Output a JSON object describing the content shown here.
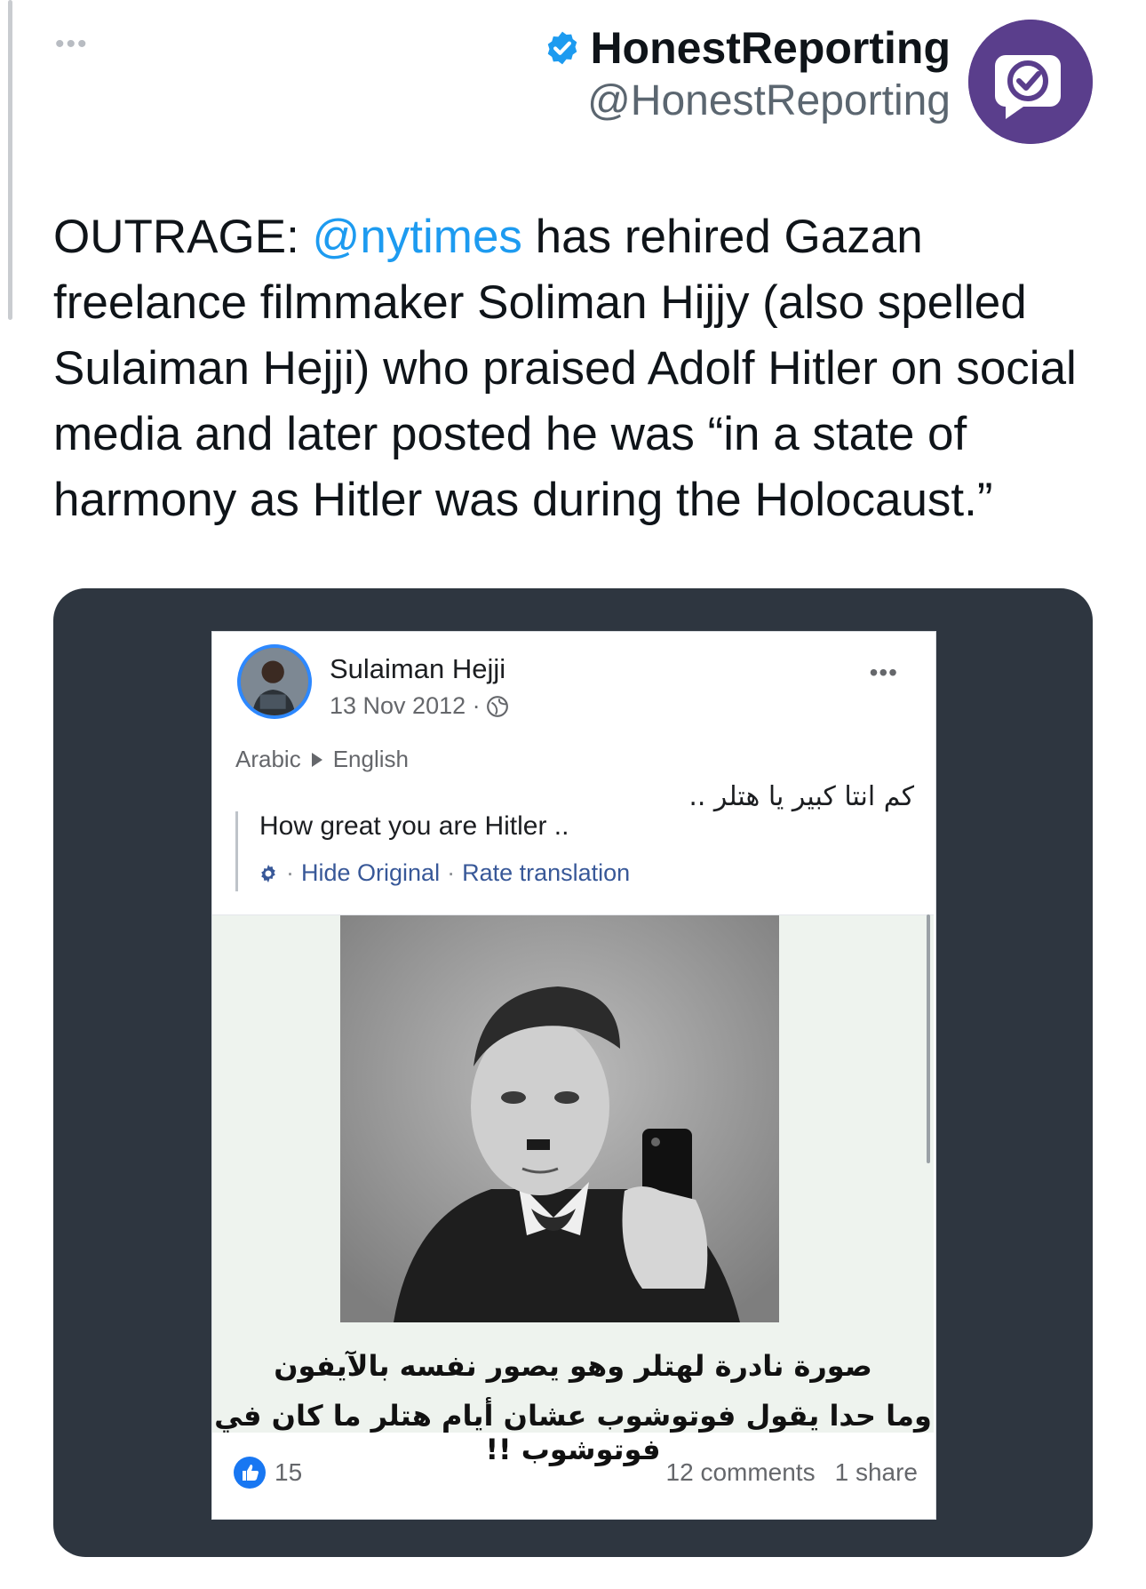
{
  "tweet": {
    "more_label": "•••",
    "author_name": "HonestReporting",
    "author_handle": "@HonestReporting",
    "text_prefix": "OUTRAGE: ",
    "mention": "@nytimes",
    "text_suffix": " has rehired Gazan freelance filmmaker Soliman Hijjy (also spelled Sulaiman Hejji) who praised Adolf Hitler on social media and later posted he was “in a state of harmony as Hitler was during the Holocaust.”",
    "icons": {
      "verified": "verified-badge-icon",
      "avatar": "honestreporting-logo"
    },
    "colors": {
      "link": "#1d9bf0",
      "verified": "#1d9bf0",
      "avatar_bg": "#5a3e8c",
      "media_bg": "#2e3640"
    }
  },
  "embedded_post": {
    "author_name": "Sulaiman Hejji",
    "date": "13 Nov 2012 ·",
    "more_label": "•••",
    "source_language": "Arabic",
    "target_language": "English",
    "original_text": "كم انتا كبير يا هتلر ..",
    "translation": "How great you are Hitler ..",
    "hide_original": "Hide Original",
    "rate_translation": "Rate translation",
    "action_separator": "·",
    "caption_line1": "صورة نادرة لهتلر وهو يصور نفسه بالآيفون",
    "caption_line2": "وما حدا يقول فوتوشوب عشان أيام هتلر ما كان في فوتوشوب !!",
    "likes": "15",
    "comments": "12 comments",
    "shares": "1 share",
    "colors": {
      "link": "#385898",
      "like": "#1877f2"
    }
  }
}
